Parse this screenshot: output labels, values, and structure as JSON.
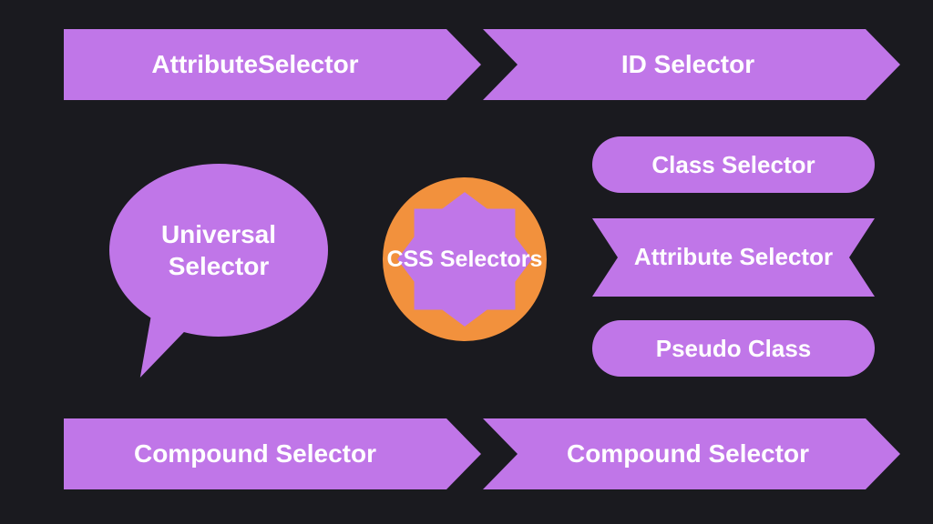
{
  "colors": {
    "background": "#1a1a1f",
    "shape_fill": "#c076e8",
    "badge_ring": "#f2913d",
    "text": "#ffffff"
  },
  "center": {
    "label": "CSS Selectors"
  },
  "shapes": {
    "top_left_arrow": "AttributeSelector",
    "top_right_arrow": "ID Selector",
    "speech_bubble": "Universal Selector",
    "pill_class": "Class Selector",
    "ribbon_attribute": "Attribute Selector",
    "pill_pseudo": "Pseudo Class",
    "bottom_left_arrow": "Compound Selector",
    "bottom_right_arrow": "Compound Selector"
  }
}
